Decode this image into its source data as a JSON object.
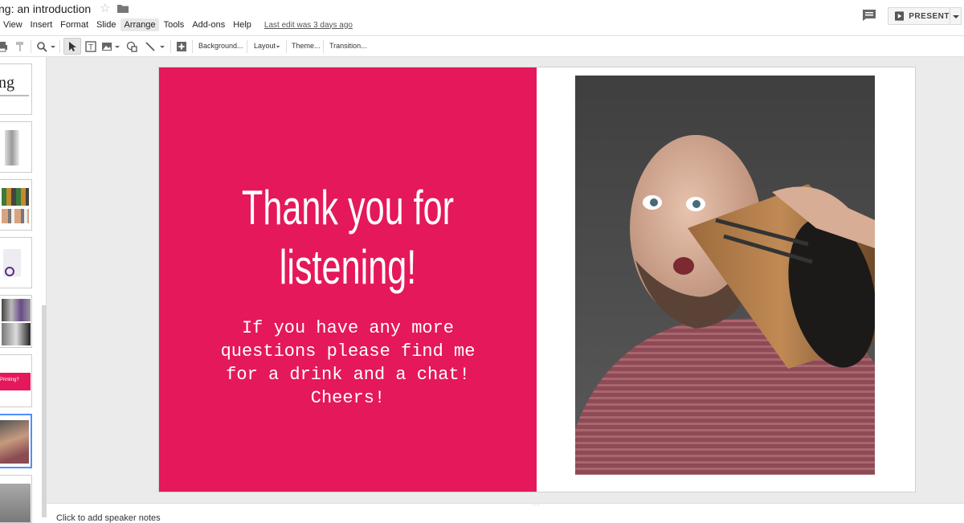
{
  "document": {
    "title": "ng: an introduction",
    "last_edit": "Last edit was 3 days ago"
  },
  "menu": [
    "View",
    "Insert",
    "Format",
    "Slide",
    "Arrange",
    "Tools",
    "Add-ons",
    "Help"
  ],
  "menu_active_index": 4,
  "toolbar": {
    "background": "Background...",
    "layout": "Layout",
    "theme": "Theme...",
    "transition": "Transition..."
  },
  "present": {
    "label": "PRESENT"
  },
  "slide": {
    "heading": "Thank you for\nlistening!",
    "body": "If you have any more\nquestions please find me\nfor a drink and a chat!\nCheers!",
    "accent_color": "#e4185a"
  },
  "filmstrip": {
    "thumb1_text": "ng",
    "thumb6_text": "Printing?",
    "selected_index": 7
  },
  "notes": {
    "placeholder": "Click to add speaker notes"
  }
}
